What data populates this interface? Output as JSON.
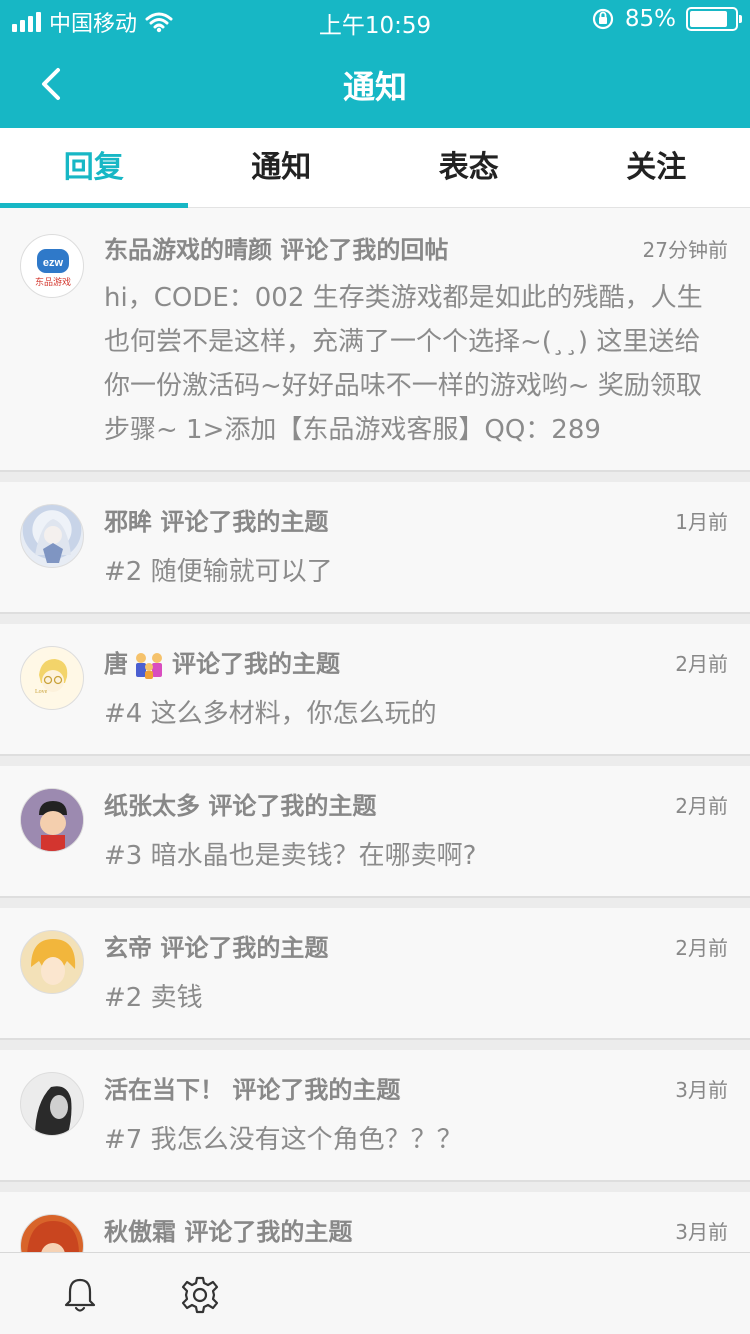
{
  "status_bar": {
    "carrier": "中国移动",
    "time": "上午10:59",
    "battery": "85%",
    "battery_level": 0.85
  },
  "header": {
    "title": "通知",
    "back_icon": "chevron-left-icon"
  },
  "tabs": [
    {
      "label": "回复",
      "active": true
    },
    {
      "label": "通知",
      "active": false
    },
    {
      "label": "表态",
      "active": false
    },
    {
      "label": "关注",
      "active": false
    }
  ],
  "notifications": [
    {
      "headline": "东品游戏的晴颜 评论了我的回帖",
      "time": "27分钟前",
      "body": "hi，CODE：002 生存类游戏都是如此的残酷，人生也何尝不是这样，充满了一个个选择~(¸¸) 这里送给你一份激活码~好好品味不一样的游戏哟~ 奖励领取步骤~ 1>添加【东品游戏客服】QQ：289",
      "avatar_text": "东品游戏"
    },
    {
      "headline": "邪眸 评论了我的主题",
      "time": "1月前",
      "body": "#2 随便输就可以了"
    },
    {
      "name": "唐",
      "action": "评论了我的主题",
      "time": "2月前",
      "body": "#4 这么多材料，你怎么玩的"
    },
    {
      "headline": "纸张太多 评论了我的主题",
      "time": "2月前",
      "body": "#3 暗水晶也是卖钱？在哪卖啊?"
    },
    {
      "headline": "玄帝 评论了我的主题",
      "time": "2月前",
      "body": "#2 卖钱"
    },
    {
      "headline": "活在当下！ 评论了我的主题",
      "time": "3月前",
      "body": "#7 我怎么没有这个角色？？？"
    },
    {
      "headline": "秋傲霜 评论了我的主题",
      "time": "3月前"
    }
  ],
  "bottom_bar": {
    "icons": [
      "bell-icon",
      "gear-icon"
    ]
  },
  "colors": {
    "accent": "#17b7c5",
    "text_muted": "#888888"
  }
}
